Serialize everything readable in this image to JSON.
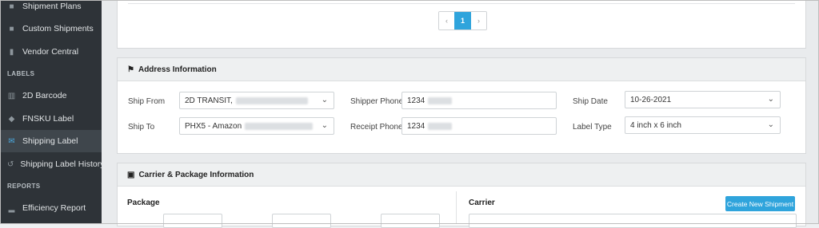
{
  "sidebar": {
    "items": [
      {
        "label": "Shipment Plans",
        "icon": "truck-icon"
      },
      {
        "label": "Custom Shipments",
        "icon": "truck-icon"
      },
      {
        "label": "Vendor Central",
        "icon": "chart-icon"
      }
    ],
    "sections": {
      "labels": "LABELS",
      "reports": "REPORTS"
    },
    "label_items": [
      {
        "label": "2D Barcode",
        "icon": "barcode-icon"
      },
      {
        "label": "FNSKU Label",
        "icon": "tag-icon"
      },
      {
        "label": "Shipping Label",
        "icon": "envelope-icon",
        "active": true
      },
      {
        "label": "Shipping Label History",
        "icon": "history-icon"
      }
    ],
    "report_items": [
      {
        "label": "Efficiency Report",
        "icon": "bar-chart-icon"
      }
    ]
  },
  "pagination": {
    "prev": "‹",
    "current": "1",
    "next": "›"
  },
  "address": {
    "title": "Address Information",
    "ship_from_label": "Ship From",
    "ship_from_value": "2D TRANSIT,",
    "ship_to_label": "Ship To",
    "ship_to_value": "PHX5 - Amazon",
    "shipper_phone_label": "Shipper Phone",
    "shipper_phone_value": "1234",
    "receipt_phone_label": "Receipt Phone",
    "receipt_phone_value": "1234",
    "ship_date_label": "Ship Date",
    "ship_date_value": "10-26-2021",
    "label_type_label": "Label Type",
    "label_type_value": "4 inch x 6 inch"
  },
  "carrier": {
    "title": "Carrier & Package Information",
    "package_title": "Package",
    "carrier_title": "Carrier",
    "create_button": "Create New Shipment"
  }
}
